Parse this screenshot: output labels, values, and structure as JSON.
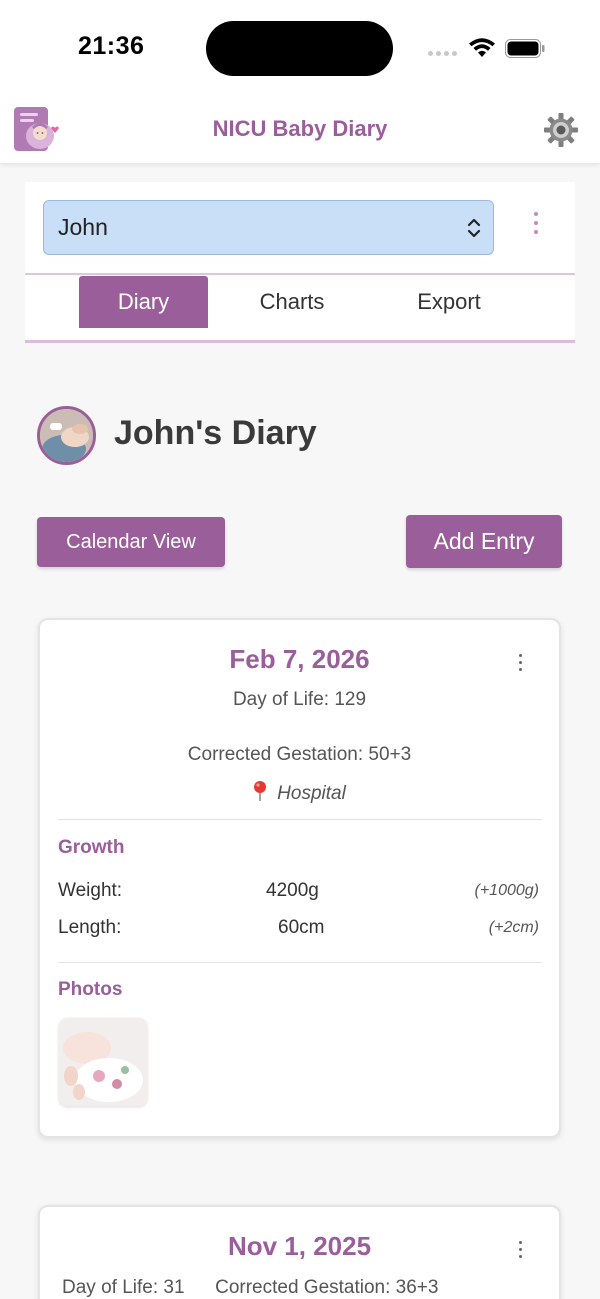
{
  "status_bar": {
    "time": "21:36"
  },
  "header": {
    "title": "NICU Baby Diary",
    "logo_icon": "baby-diary-logo-icon",
    "settings_icon": "gear-icon"
  },
  "selector": {
    "selected_baby": "John"
  },
  "tabs": [
    {
      "label": "Diary",
      "active": true
    },
    {
      "label": "Charts",
      "active": false
    },
    {
      "label": "Export",
      "active": false
    }
  ],
  "diary": {
    "title": "John's Diary",
    "calendar_button": "Calendar View",
    "add_button": "Add Entry"
  },
  "entries": [
    {
      "date": "Feb 7, 2026",
      "day_of_life": "Day of Life: 129",
      "corrected_gestation": "Corrected Gestation: 50+3",
      "location": "Hospital",
      "growth_title": "Growth",
      "growth": [
        {
          "label": "Weight:",
          "value": "4200g",
          "change": "(+1000g)"
        },
        {
          "label": "Length:",
          "value": "60cm",
          "change": "(+2cm)"
        }
      ],
      "photos_title": "Photos"
    },
    {
      "date": "Nov 1, 2025",
      "day_of_life": "Day of Life: 31",
      "corrected_gestation": "Corrected Gestation: 36+3"
    }
  ],
  "colors": {
    "accent": "#9a5e9a",
    "select_bg": "#c9dff7",
    "background": "#f7f7f7"
  }
}
